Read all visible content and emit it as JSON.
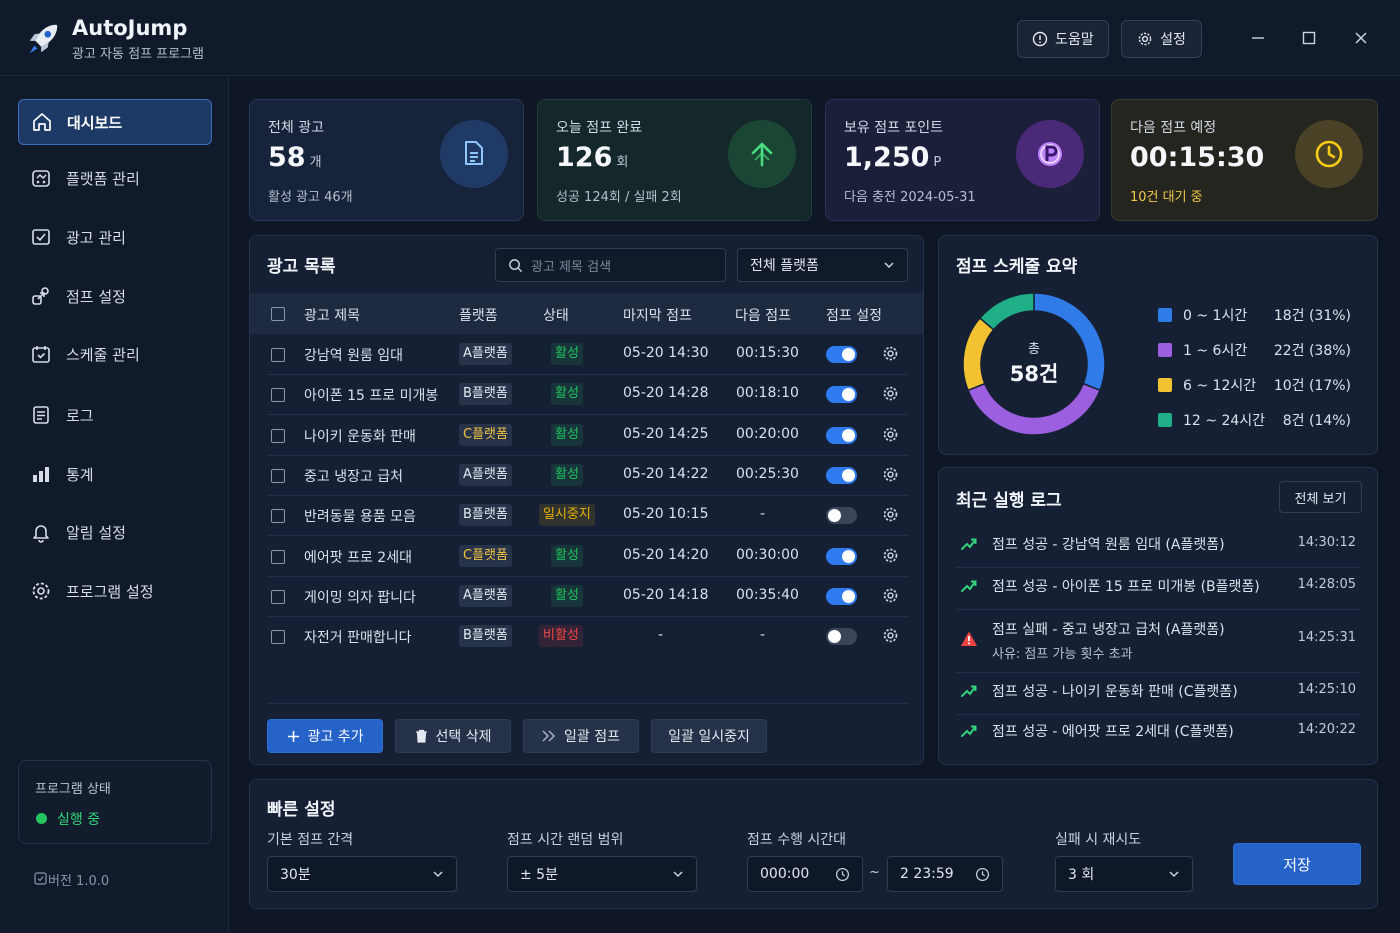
{
  "app": {
    "title": "AutoJump",
    "subtitle": "광고 자동 점프 프로그램"
  },
  "header": {
    "help_label": "도움말",
    "settings_label": "설정"
  },
  "sidebar": {
    "items": [
      {
        "label": "대시보드",
        "icon": "home-icon",
        "active": true
      },
      {
        "label": "플랫폼 관리",
        "icon": "platform-icon"
      },
      {
        "label": "광고 관리",
        "icon": "ad-icon"
      },
      {
        "label": "점프 설정",
        "icon": "jump-icon"
      },
      {
        "label": "스케줄 관리",
        "icon": "calendar-icon"
      },
      {
        "label": "로그",
        "icon": "log-icon"
      },
      {
        "label": "통계",
        "icon": "chart-icon"
      },
      {
        "label": "알림 설정",
        "icon": "bell-icon"
      },
      {
        "label": "프로그램 설정",
        "icon": "gear-icon"
      }
    ],
    "status_label": "프로그램 상태",
    "status_value": "실행 중",
    "version": "버전 1.0.0"
  },
  "stats": [
    {
      "label": "전체 광고",
      "value": "58",
      "unit": "개",
      "sub": "활성 광고 46개",
      "icon": "document-icon",
      "accent": "#3b82f6"
    },
    {
      "label": "오늘 점프 완료",
      "value": "126",
      "unit": "회",
      "sub": "성공 124회 / 실패 2회",
      "icon": "arrow-up-icon",
      "accent": "#22c55e"
    },
    {
      "label": "보유 점프 포인트",
      "value": "1,250",
      "unit": "P",
      "sub": "다음 충전 2024-05-31",
      "icon": "point-icon",
      "accent": "#a855f7"
    },
    {
      "label": "다음 점프 예정",
      "value": "00:15:30",
      "unit": "",
      "sub": "10건 대기 중",
      "icon": "clock-icon",
      "accent": "#eab308"
    }
  ],
  "ad_list": {
    "title": "광고 목록",
    "search_placeholder": "광고 제목 검색",
    "platform_filter": "전체 플랫폼",
    "columns": [
      "광고 제목",
      "플랫폼",
      "상태",
      "마지막 점프",
      "다음 점프",
      "점프 설정"
    ],
    "rows": [
      {
        "title": "강남역 원룸 임대",
        "platform": "A플랫폼",
        "pcolor": "#e5eaf2",
        "status": "활성",
        "scolor": "#22c55e",
        "last": "05-20 14:30",
        "next": "00:15:30",
        "on": true
      },
      {
        "title": "아이폰 15 프로 미개봉",
        "platform": "B플랫폼",
        "pcolor": "#e5eaf2",
        "status": "활성",
        "scolor": "#22c55e",
        "last": "05-20 14:28",
        "next": "00:18:10",
        "on": true
      },
      {
        "title": "나이키 운동화 판매",
        "platform": "C플랫폼",
        "pcolor": "#f5c542",
        "status": "활성",
        "scolor": "#22c55e",
        "last": "05-20 14:25",
        "next": "00:20:00",
        "on": true
      },
      {
        "title": "중고 냉장고 급처",
        "platform": "A플랫폼",
        "pcolor": "#e5eaf2",
        "status": "활성",
        "scolor": "#22c55e",
        "last": "05-20 14:22",
        "next": "00:25:30",
        "on": true
      },
      {
        "title": "반려동물 용품 모음",
        "platform": "B플랫폼",
        "pcolor": "#e5eaf2",
        "status": "일시중지",
        "scolor": "#eab308",
        "last": "05-20 10:15",
        "next": "-",
        "on": false
      },
      {
        "title": "에어팟 프로 2세대",
        "platform": "C플랫폼",
        "pcolor": "#f5c542",
        "status": "활성",
        "scolor": "#22c55e",
        "last": "05-20 14:20",
        "next": "00:30:00",
        "on": true
      },
      {
        "title": "게이밍 의자 팝니다",
        "platform": "A플랫폼",
        "pcolor": "#e5eaf2",
        "status": "활성",
        "scolor": "#22c55e",
        "last": "05-20 14:18",
        "next": "00:35:40",
        "on": true
      },
      {
        "title": "자전거 판매합니다",
        "platform": "B플랫폼",
        "pcolor": "#e5eaf2",
        "status": "비활성",
        "scolor": "#ef4444",
        "last": "-",
        "next": "-",
        "on": false
      }
    ],
    "buttons": {
      "add": "광고 추가",
      "delete": "선택 삭제",
      "bulk_jump": "일괄 점프",
      "bulk_pause": "일괄 일시중지"
    }
  },
  "schedule": {
    "title": "점프 스케줄 요약",
    "center_top": "총",
    "center_value": "58건",
    "segments": [
      {
        "label": "0 ~ 1시간",
        "value": 18,
        "text": "18건 (31%)",
        "color": "#2f7be8"
      },
      {
        "label": "1 ~ 6시간",
        "value": 22,
        "text": "22건 (38%)",
        "color": "#9c5fe0"
      },
      {
        "label": "6 ~ 12시간",
        "value": 10,
        "text": "10건 (17%)",
        "color": "#f2c232"
      },
      {
        "label": "12 ~ 24시간",
        "value": 8,
        "text": "8건 (14%)",
        "color": "#1fae85"
      }
    ]
  },
  "logs": {
    "title": "최근 실행 로그",
    "view_all": "전체 보기",
    "items": [
      {
        "text": "점프 성공 - 강남역 원룸 임대 (A플랫폼)",
        "time": "14:30:12",
        "type": "success"
      },
      {
        "text": "점프 성공 - 아이폰 15 프로 미개봉 (B플랫폼)",
        "time": "14:28:05",
        "type": "success"
      },
      {
        "text": "점프 실패 - 중고 냉장고 급처 (A플랫폼)",
        "sub": "사유: 점프 가능 횟수 초과",
        "time": "14:25:31",
        "type": "fail"
      },
      {
        "text": "점프 성공 - 나이키 운동화 판매 (C플랫폼)",
        "time": "14:25:10",
        "type": "success"
      },
      {
        "text": "점프 성공 - 에어팟 프로 2세대 (C플랫폼)",
        "time": "14:20:22",
        "type": "success"
      }
    ]
  },
  "quick": {
    "title": "빠른 설정",
    "interval_label": "기본 점프 간격",
    "interval_value": "30분",
    "random_label": "점프 시간 랜덤 범위",
    "random_value": "± 5분",
    "time_label": "점프 수행 시간대",
    "time_start": "000:00",
    "time_sep": "~",
    "time_end": "2 23:59",
    "retry_label": "실패 시 재시도",
    "retry_value": "3 회",
    "save": "저장"
  }
}
